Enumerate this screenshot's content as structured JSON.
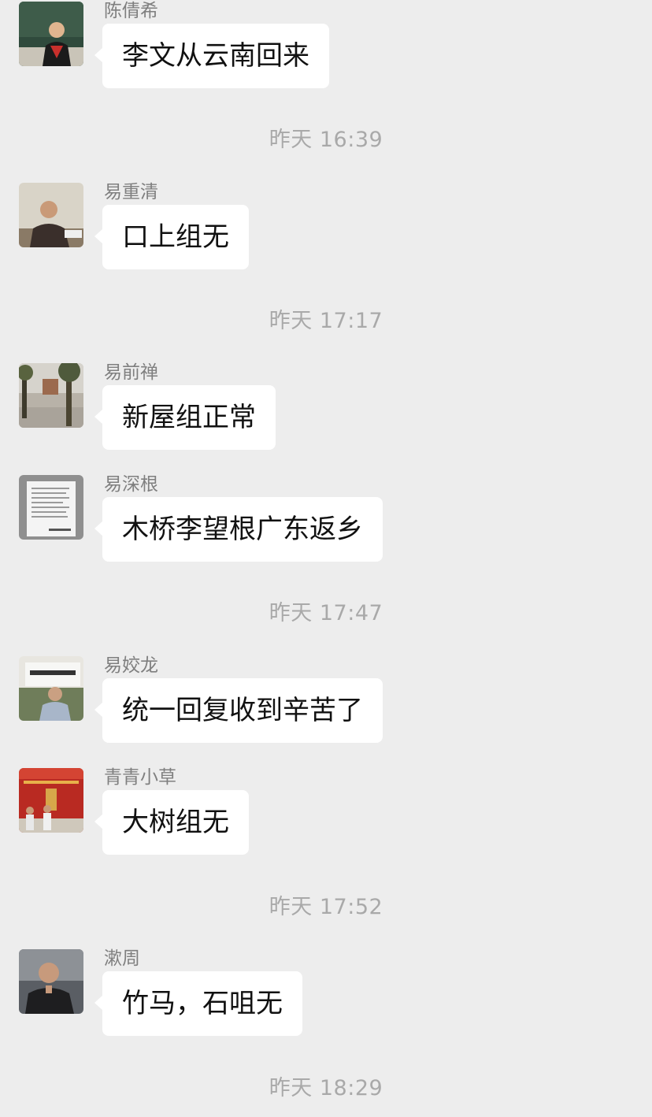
{
  "conversation": {
    "messages": [
      {
        "sender": "陈倩希",
        "text": "李文从云南回来",
        "avatar": "avatar-photo-classroom"
      },
      {
        "time": "昨天 16:39"
      },
      {
        "sender": "易重清",
        "text": "口上组无",
        "avatar": "avatar-photo-man-office"
      },
      {
        "time": "昨天 17:17"
      },
      {
        "sender": "易前禅",
        "text": "新屋组正常",
        "avatar": "avatar-photo-courtyard"
      },
      {
        "sender": "易深根",
        "text": "木桥李望根广东返乡",
        "avatar": "avatar-photo-book-page"
      },
      {
        "time": "昨天 17:47"
      },
      {
        "sender": "易姣龙",
        "text": "统一回复收到辛苦了",
        "avatar": "avatar-photo-theatre"
      },
      {
        "sender": "青青小草",
        "text": "大树组无",
        "avatar": "avatar-photo-red-hall"
      },
      {
        "time": "昨天 17:52"
      },
      {
        "sender": "漱周",
        "text": "竹马，石咀无",
        "avatar": "avatar-photo-elder-man"
      },
      {
        "time": "昨天 18:29"
      }
    ]
  }
}
